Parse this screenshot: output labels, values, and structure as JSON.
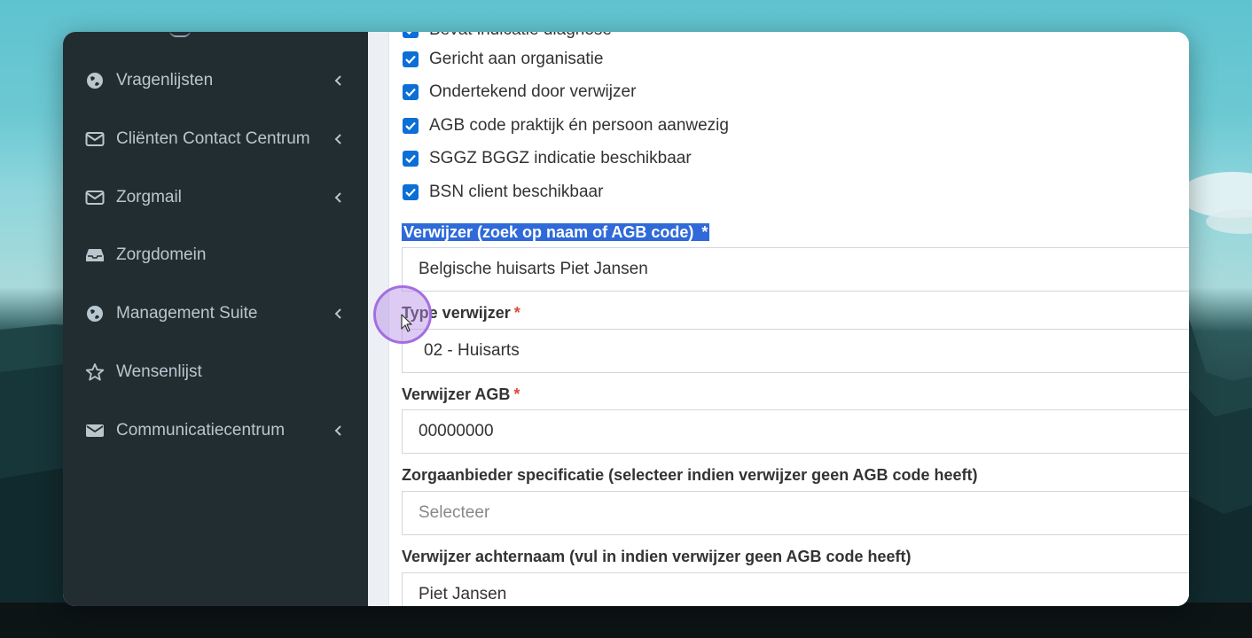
{
  "sidebar": {
    "items": [
      {
        "label": "Vragenlijsten",
        "icon": "globe-icon",
        "has_submenu": true
      },
      {
        "label": "Cliënten Contact Centrum",
        "icon": "envelope-icon",
        "has_submenu": true
      },
      {
        "label": "Zorgmail",
        "icon": "envelope-icon",
        "has_submenu": true
      },
      {
        "label": "Zorgdomein",
        "icon": "inbox-icon",
        "has_submenu": false
      },
      {
        "label": "Management Suite",
        "icon": "globe-icon",
        "has_submenu": true
      },
      {
        "label": "Wensenlijst",
        "icon": "star-icon",
        "has_submenu": false
      },
      {
        "label": "Communicatiecentrum",
        "icon": "envelope-filled-icon",
        "has_submenu": true
      }
    ]
  },
  "form": {
    "checkboxes": [
      {
        "label": "Bevat indicatie diagnose",
        "checked": true
      },
      {
        "label": "Gericht aan organisatie",
        "checked": true
      },
      {
        "label": "Ondertekend door verwijzer",
        "checked": true
      },
      {
        "label": "AGB code praktijk én persoon aanwezig",
        "checked": true
      },
      {
        "label": "SGGZ BGGZ indicatie beschikbaar",
        "checked": true
      },
      {
        "label": "BSN client beschikbaar",
        "checked": true
      }
    ],
    "verwijzer": {
      "label": "Verwijzer (zoek op naam of AGB code)",
      "required": "*",
      "value": "Belgische huisarts Piet Jansen"
    },
    "type_verwijzer": {
      "label": "Type verwijzer",
      "required": "*",
      "value": "02 - Huisarts"
    },
    "verwijzer_agb": {
      "label": "Verwijzer AGB",
      "required": "*",
      "value": "00000000"
    },
    "zorgaanbieder": {
      "label": "Zorgaanbieder specificatie (selecteer indien verwijzer geen AGB code heeft)",
      "placeholder": "Selecteer"
    },
    "achternaam": {
      "label": "Verwijzer achternaam (vul in indien verwijzer geen AGB code heeft)",
      "value": "Piet Jansen"
    }
  },
  "colors": {
    "sidebar_bg": "#222d32",
    "sidebar_text": "#b8c7ce",
    "checkbox": "#0b6fd6",
    "required": "#dd4b39",
    "selection": "#2f6ad8",
    "cursor_highlight": "#a56ee0"
  }
}
